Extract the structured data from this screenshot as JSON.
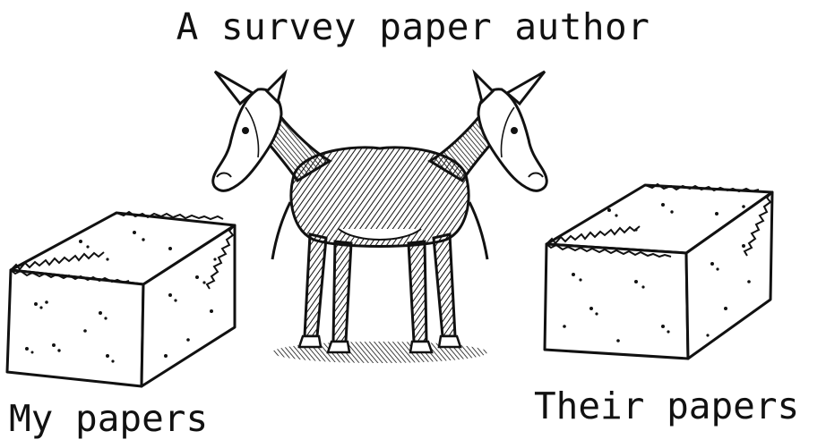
{
  "title": "A survey paper author",
  "labels": {
    "left": "My papers",
    "right": "Their papers"
  },
  "illustration": {
    "center": "two-headed-donkey",
    "left": "hay-bale",
    "right": "hay-bale",
    "style": "black-and-white line drawing"
  }
}
